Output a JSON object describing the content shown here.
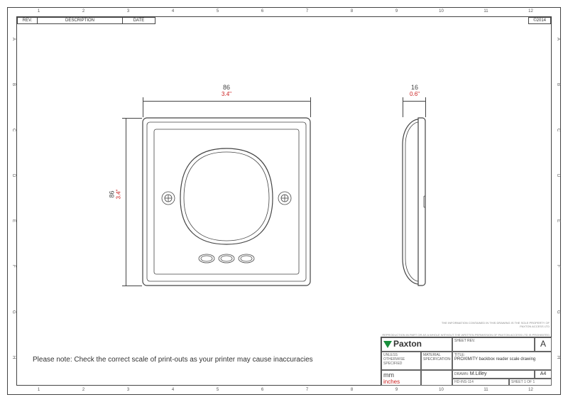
{
  "ruler_cols": [
    "1",
    "2",
    "3",
    "4",
    "5",
    "6",
    "7",
    "8",
    "9",
    "10",
    "11",
    "12"
  ],
  "ruler_rows": [
    "A",
    "B",
    "C",
    "D",
    "E",
    "F",
    "G",
    "H"
  ],
  "revision_headers": {
    "rev": "REV.",
    "desc": "DESCRIPTION",
    "date": "DATE"
  },
  "copyright": "©2014",
  "dims": {
    "front_w_mm": "86",
    "front_w_in": "3.4\"",
    "front_h_mm": "86",
    "front_h_in": "3.4\"",
    "side_w_mm": "16",
    "side_w_in": "0.6\""
  },
  "note": "Please note: Check the correct scale of print-outs as your printer may cause inaccuracies",
  "fineprint1": "THE INFORMATION CONTAINED IN THIS DRAWING IS THE SOLE PROPERTY OF",
  "fineprint2": "PAXTON ACCESS LTD",
  "fineprint3": "REPRODUCTION IN PART OR AS A WHOLE WITHOUT THE WRITTEN PERMISSION OF PAXTON ACCESS LTD IS PROHIBITED",
  "titleblock": {
    "logo": "Paxton",
    "sheet_rev_lbl": "SHEET REV.",
    "sheet_rev": "A",
    "title_lbl": "TITLE:",
    "title": "PROXIMITY backbox reader scale drawing",
    "drawn_lbl": "DRAWN:",
    "drawn": "M.Lilley",
    "size_lbl": "",
    "size": "A4",
    "units_mm": "mm",
    "units_in": "inches",
    "dwgno_lbl": "",
    "dwgno": "HD-INS-114",
    "sheet": "SHEET 1 OF 1",
    "matspec": "MATERIAL SPECIFICATION:",
    "scale_lbl": "UNLESS OTHERWISE SPECIFIED"
  }
}
